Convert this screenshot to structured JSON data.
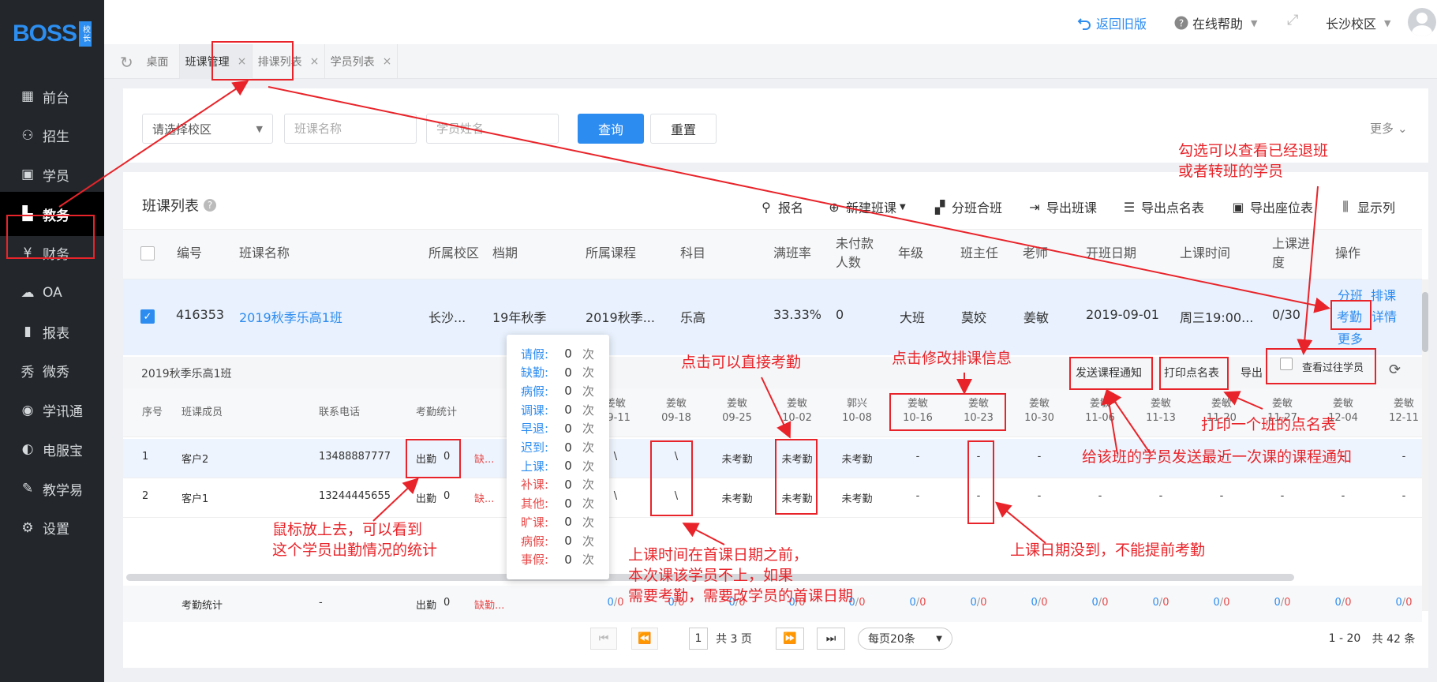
{
  "app": {
    "logo_text": "BOSS",
    "logo_badge": "校长"
  },
  "sidebar": {
    "items": [
      {
        "label": "前台",
        "icon": "calendar-icon"
      },
      {
        "label": "招生",
        "icon": "user-plus-icon"
      },
      {
        "label": "学员",
        "icon": "id-card-icon"
      },
      {
        "label": "教务",
        "icon": "book-icon",
        "active": true
      },
      {
        "label": "财务",
        "icon": "yen-icon"
      },
      {
        "label": "OA",
        "icon": "cloud-icon"
      },
      {
        "label": "报表",
        "icon": "bar-chart-icon"
      },
      {
        "label": "微秀",
        "icon": "weixiu-icon"
      },
      {
        "label": "学讯通",
        "icon": "location-pin-icon"
      },
      {
        "label": "电服宝",
        "icon": "phone-signal-icon"
      },
      {
        "label": "教学易",
        "icon": "teaching-icon"
      },
      {
        "label": "设置",
        "icon": "gear-icon"
      }
    ]
  },
  "header": {
    "back_label": "返回旧版",
    "help_label": "在线帮助",
    "campus": "长沙校区"
  },
  "tabs": [
    {
      "label": "桌面",
      "closable": false
    },
    {
      "label": "班课管理",
      "closable": true,
      "active": true
    },
    {
      "label": "排课列表",
      "closable": true
    },
    {
      "label": "学员列表",
      "closable": true
    }
  ],
  "filters": {
    "campus_select": "请选择校区",
    "class_name_placeholder": "班课名称",
    "student_name_placeholder": "学员姓名",
    "search_label": "查询",
    "reset_label": "重置",
    "more_label": "更多"
  },
  "list": {
    "title": "班课列表",
    "toolbar": {
      "enroll": "报名",
      "new_class": "新建班课",
      "split_merge": "分班合班",
      "export_class": "导出班课",
      "export_roll": "导出点名表",
      "export_seat": "导出座位表",
      "show_columns": "显示列"
    },
    "headers": {
      "no": "编号",
      "name": "班课名称",
      "campus": "所属校区",
      "period": "档期",
      "course": "所属课程",
      "subject": "科目",
      "fill_rate": "满班率",
      "unpaid_1": "未付款",
      "unpaid_2": "人数",
      "grade": "年级",
      "head_teacher": "班主任",
      "teacher": "老师",
      "start_date": "开班日期",
      "class_time": "上课时间",
      "progress_1": "上课进",
      "progress_2": "度",
      "ops": "操作"
    },
    "row": {
      "no": "416353",
      "name": "2019秋季乐高1班",
      "campus": "长沙...",
      "period": "19年秋季",
      "course": "2019秋季...",
      "subject": "乐高",
      "fill_rate": "33.33%",
      "unpaid": "0",
      "grade": "大班",
      "head_teacher": "莫姣",
      "teacher": "姜敏",
      "start_date": "2019-09-01",
      "class_time": "周三19:00...",
      "progress": "0/30",
      "op_split": "分班",
      "op_schedule": "排课",
      "op_attend": "考勤",
      "op_detail": "详情",
      "op_more": "更多"
    }
  },
  "sub": {
    "class_title": "2019秋季乐高1班",
    "notify_btn": "发送课程通知",
    "print_btn": "打印点名表",
    "export_btn": "导出",
    "past_label": "查看过往学员",
    "headers": {
      "idx": "序号",
      "member": "班课成员",
      "phone": "联系电话",
      "stats": "考勤统计"
    },
    "lessons": [
      {
        "t": "姜敏",
        "d": "09-11"
      },
      {
        "t": "姜敏",
        "d": "09-18"
      },
      {
        "t": "姜敏",
        "d": "09-25"
      },
      {
        "t": "姜敏",
        "d": "10-02"
      },
      {
        "t": "郭兴",
        "d": "10-08"
      },
      {
        "t": "姜敏",
        "d": "10-16"
      },
      {
        "t": "姜敏",
        "d": "10-23"
      },
      {
        "t": "姜敏",
        "d": "10-30"
      },
      {
        "t": "姜敏",
        "d": "11-06"
      },
      {
        "t": "姜敏",
        "d": "11-13"
      },
      {
        "t": "姜敏",
        "d": "11-20"
      },
      {
        "t": "姜敏",
        "d": "11-27"
      },
      {
        "t": "姜敏",
        "d": "12-04"
      },
      {
        "t": "姜敏",
        "d": "12-11"
      }
    ],
    "rows": [
      {
        "idx": "1",
        "name": "客户2",
        "phone": "13488887777",
        "present": "出勤",
        "present_n": "0",
        "absent": "缺...",
        "cells": [
          "\\",
          "\\",
          "未考勤",
          "未考勤",
          "未考勤",
          "-",
          "-",
          "-",
          "-",
          "-",
          "-",
          "-",
          "-",
          "-"
        ]
      },
      {
        "idx": "2",
        "name": "客户1",
        "phone": "13244445655",
        "present": "出勤",
        "present_n": "0",
        "absent": "缺...",
        "cells": [
          "\\",
          "\\",
          "未考勤",
          "未考勤",
          "未考勤",
          "-",
          "-",
          "-",
          "-",
          "-",
          "-",
          "-",
          "-",
          "-"
        ]
      }
    ],
    "footer": {
      "label": "考勤统计",
      "phone": "-",
      "present": "出勤",
      "present_n": "0",
      "absent": "缺勤...",
      "cells": [
        "0/0",
        "0/0",
        "0/0",
        "0/0",
        "0/0",
        "0/0",
        "0/0",
        "0/0",
        "0/0",
        "0/0",
        "0/0",
        "0/0",
        "0/0",
        "0/0"
      ]
    }
  },
  "popup": {
    "items": [
      {
        "label": "请假:",
        "value": "0",
        "unit": "次",
        "color": "#2d8cf0"
      },
      {
        "label": "缺勤:",
        "value": "0",
        "unit": "次",
        "color": "#2d8cf0"
      },
      {
        "label": "病假:",
        "value": "0",
        "unit": "次",
        "color": "#2d8cf0"
      },
      {
        "label": "调课:",
        "value": "0",
        "unit": "次",
        "color": "#2d8cf0"
      },
      {
        "label": "早退:",
        "value": "0",
        "unit": "次",
        "color": "#2d8cf0"
      },
      {
        "label": "迟到:",
        "value": "0",
        "unit": "次",
        "color": "#2d8cf0"
      },
      {
        "label": "上课:",
        "value": "0",
        "unit": "次",
        "color": "#2d8cf0"
      },
      {
        "label": "补课:",
        "value": "0",
        "unit": "次",
        "color": "#e84a4a"
      },
      {
        "label": "其他:",
        "value": "0",
        "unit": "次",
        "color": "#e84a4a"
      },
      {
        "label": "旷课:",
        "value": "0",
        "unit": "次",
        "color": "#e84a4a"
      },
      {
        "label": "病假:",
        "value": "0",
        "unit": "次",
        "color": "#e84a4a"
      },
      {
        "label": "事假:",
        "value": "0",
        "unit": "次",
        "color": "#e84a4a"
      }
    ]
  },
  "pagination": {
    "page": "1",
    "total_pages": "共 3 页",
    "page_size": "每页20条",
    "range": "1 - 20",
    "total": "共 42 条"
  },
  "annotations": {
    "past": "勾选可以查看已经退班\n或者转班的学员",
    "direct_attend": "点击可以直接考勤",
    "edit_schedule": "点击修改排课信息",
    "print_roll": "打印一个班的点名表",
    "notify": "给该班的学员发送最近一次课的课程通知",
    "hover": "鼠标放上去，可以看到\n这个学员出勤情况的统计",
    "before_first": "上课时间在首课日期之前，\n本次课该学员不上，如果\n需要考勤，需要改学员的首课日期",
    "not_yet": "上课日期没到，不能提前考勤"
  },
  "colors": {
    "accent": "#2d8cf0",
    "annotation": "#e8242a",
    "sidebar_bg": "#23272b"
  }
}
